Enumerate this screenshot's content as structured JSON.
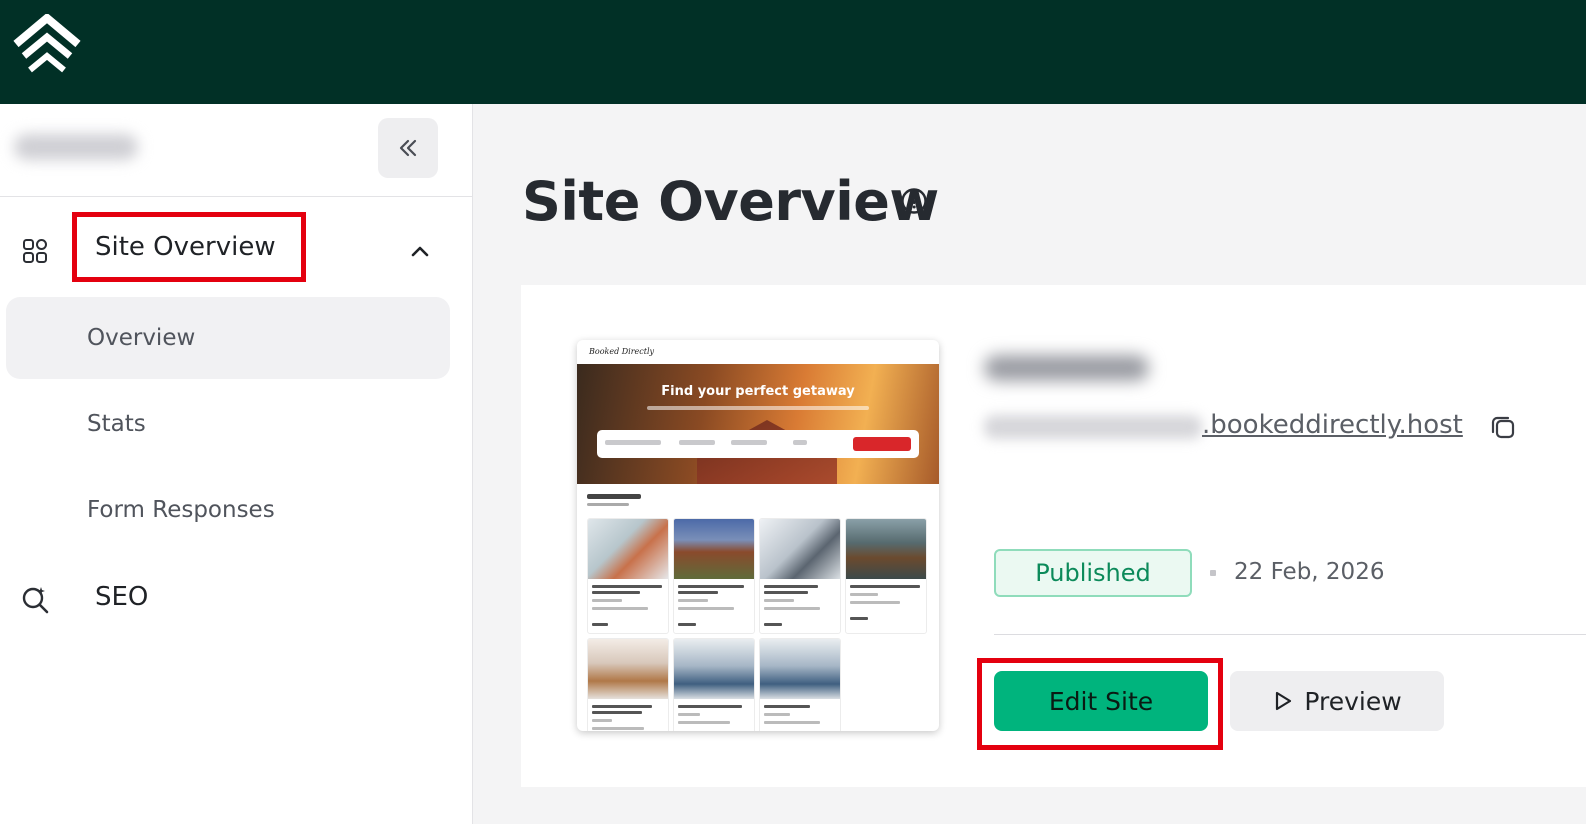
{
  "sidebar": {
    "section": {
      "title": "Site Overview",
      "items": [
        {
          "label": "Overview"
        },
        {
          "label": "Stats"
        },
        {
          "label": "Form Responses"
        }
      ]
    },
    "seo": {
      "label": "SEO"
    }
  },
  "main": {
    "title": "Site Overview",
    "site": {
      "url_visible": ".bookeddirectly.host",
      "status": "Published",
      "date": "22 Feb, 2026"
    },
    "actions": {
      "edit_label": "Edit Site",
      "preview_label": "Preview"
    },
    "thumbnail": {
      "brand": "Booked Directly",
      "hero_title": "Find your perfect getaway"
    }
  },
  "colors": {
    "topbar": "#013026",
    "accent": "#00b47d",
    "highlight": "#e4000f",
    "published": "#0c8a5a"
  }
}
